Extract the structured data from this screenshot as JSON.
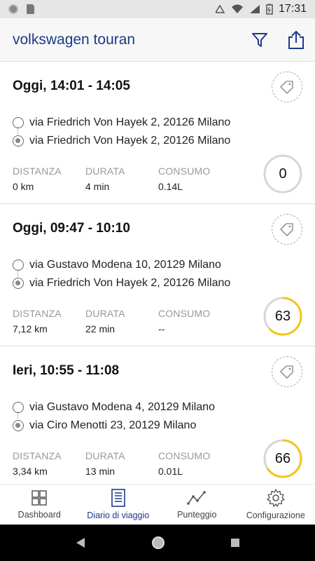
{
  "status_bar": {
    "time": "17:31"
  },
  "app_bar": {
    "title": "volkswagen touran",
    "filter_icon": "filter-icon",
    "share_icon": "share-icon"
  },
  "trips": [
    {
      "time": "Oggi, 14:01 - 14:05",
      "from": "via Friedrich Von Hayek 2, 20126 Milano",
      "to": "via Friedrich Von Hayek 2, 20126 Milano",
      "stats": [
        {
          "label": "DISTANZA",
          "value": "0 km"
        },
        {
          "label": "DURATA",
          "value": "4 min"
        },
        {
          "label": "CONSUMO",
          "value": "0.14L"
        }
      ],
      "score": "0",
      "score_fraction": 0
    },
    {
      "time": "Oggi, 09:47 - 10:10",
      "from": "via Gustavo Modena 10, 20129 Milano",
      "to": "via Friedrich Von Hayek 2, 20126 Milano",
      "stats": [
        {
          "label": "DISTANZA",
          "value": "7,12 km"
        },
        {
          "label": "DURATA",
          "value": "22 min"
        },
        {
          "label": "CONSUMO",
          "value": "--"
        }
      ],
      "score": "63",
      "score_fraction": 0.63
    },
    {
      "time": "Ieri, 10:55 - 11:08",
      "from": "via Gustavo Modena 4, 20129 Milano",
      "to": "via Ciro Menotti 23, 20129 Milano",
      "stats": [
        {
          "label": "DISTANZA",
          "value": "3,34 km"
        },
        {
          "label": "DURATA",
          "value": "13 min"
        },
        {
          "label": "CONSUMO",
          "value": "0.01L"
        }
      ],
      "score": "66",
      "score_fraction": 0.66
    }
  ],
  "bottom_nav": [
    {
      "label": "Dashboard",
      "icon": "dashboard-icon",
      "active": false
    },
    {
      "label": "Diario di viaggio",
      "icon": "journal-icon",
      "active": true
    },
    {
      "label": "Punteggio",
      "icon": "chart-icon",
      "active": false
    },
    {
      "label": "Configurazione",
      "icon": "gear-icon",
      "active": false
    }
  ],
  "colors": {
    "accent": "#1a3a8a",
    "score_ring": "#f5c518",
    "ring_track": "#d6d6d6"
  }
}
